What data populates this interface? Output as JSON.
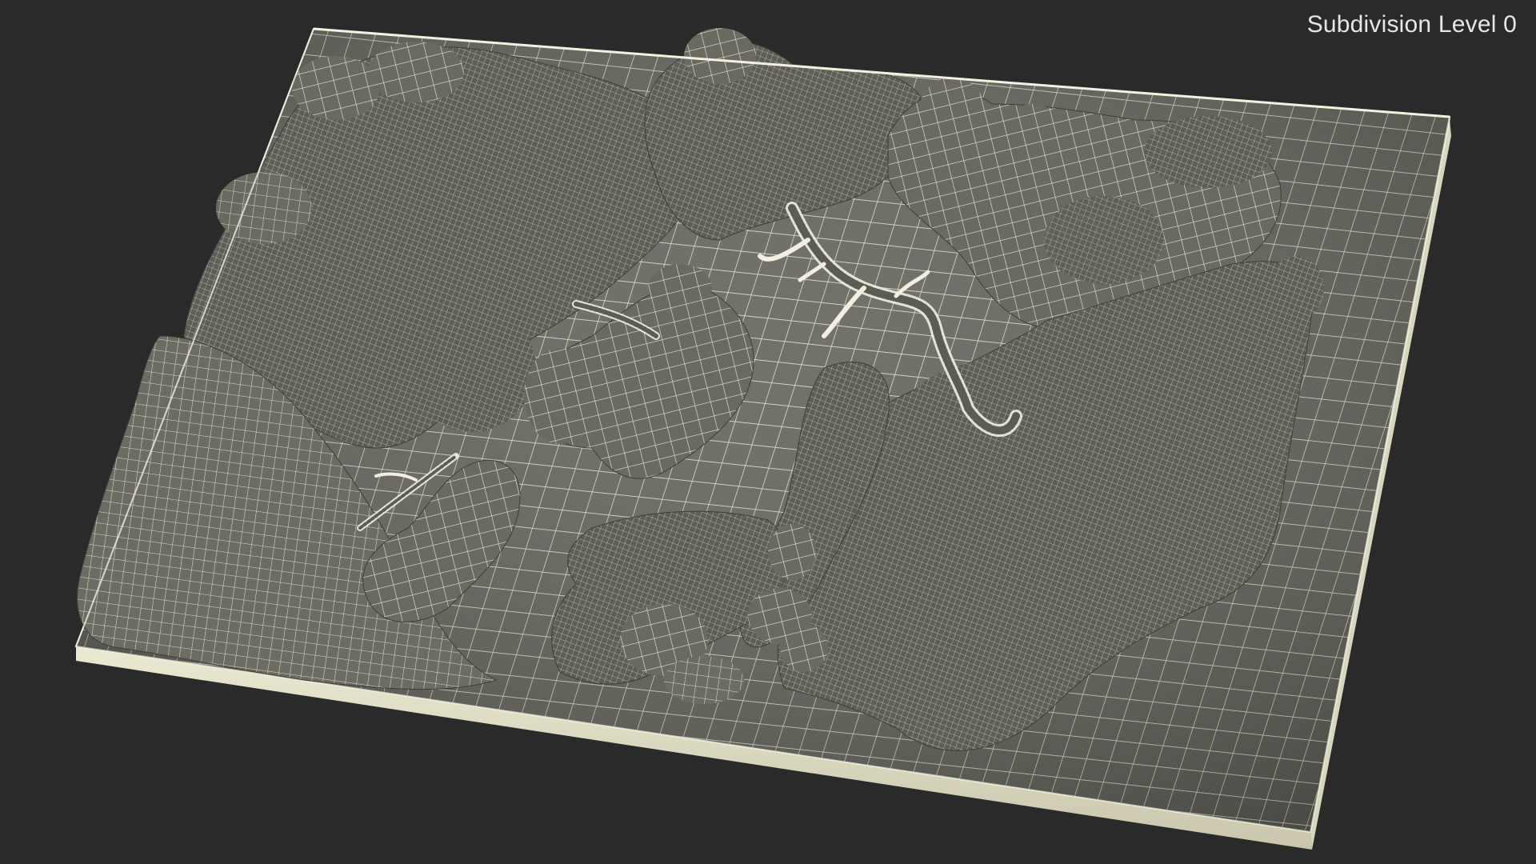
{
  "viewport": {
    "label": "Subdivision Level 0",
    "background_color": "#2a2a2a",
    "model_base_color": "#6b6b62",
    "model_wire_color": "#efeedf",
    "model_edge_color": "#d8d6c2"
  },
  "scene": {
    "subject": "terrain-slab-model",
    "render_style": "wireframe-on-shaded"
  }
}
